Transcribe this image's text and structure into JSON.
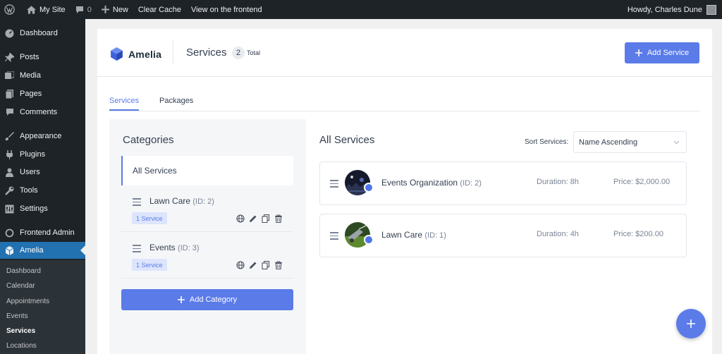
{
  "adminbar": {
    "site_name": "My Site",
    "comments_count": "0",
    "new_label": "New",
    "clear_cache_label": "Clear Cache",
    "view_frontend_label": "View on the frontend",
    "howdy_label": "Howdy, Charles Dune"
  },
  "sidebar": {
    "items": [
      {
        "label": "Dashboard",
        "icon": "dashboard-icon"
      },
      {
        "label": "Posts",
        "icon": "pin-icon"
      },
      {
        "label": "Media",
        "icon": "media-icon"
      },
      {
        "label": "Pages",
        "icon": "pages-icon"
      },
      {
        "label": "Comments",
        "icon": "comment-icon"
      },
      {
        "label": "Appearance",
        "icon": "brush-icon"
      },
      {
        "label": "Plugins",
        "icon": "plug-icon"
      },
      {
        "label": "Users",
        "icon": "user-icon"
      },
      {
        "label": "Tools",
        "icon": "wrench-icon"
      },
      {
        "label": "Settings",
        "icon": "settings-icon"
      },
      {
        "label": "Frontend Admin",
        "icon": "circle-icon"
      },
      {
        "label": "Amelia",
        "icon": "amelia-icon"
      }
    ],
    "submenu": [
      "Dashboard",
      "Calendar",
      "Appointments",
      "Events",
      "Services",
      "Locations"
    ]
  },
  "header": {
    "logo_text": "Amelia",
    "title": "Services",
    "count": "2",
    "total_label": "Total",
    "add_service_label": "Add Service"
  },
  "tabs": [
    "Services",
    "Packages"
  ],
  "categories": {
    "title": "Categories",
    "all_label": "All Services",
    "items": [
      {
        "name": "Lawn Care",
        "id": "(ID: 2)",
        "badge": "1 Service"
      },
      {
        "name": "Events",
        "id": "(ID: 3)",
        "badge": "1 Service"
      }
    ],
    "add_label": "Add Category"
  },
  "services": {
    "title": "All Services",
    "sort_label": "Sort Services:",
    "sort_value": "Name Ascending",
    "items": [
      {
        "name": "Events Organization",
        "id": "(ID: 2)",
        "duration": "Duration: 8h",
        "price": "Price: $2,000.00"
      },
      {
        "name": "Lawn Care",
        "id": "(ID: 1)",
        "duration": "Duration: 4h",
        "price": "Price: $200.00"
      }
    ]
  },
  "colors": {
    "accent": "#5a7be8",
    "wp_blue": "#2271b1",
    "admin_dark": "#1d2327"
  }
}
